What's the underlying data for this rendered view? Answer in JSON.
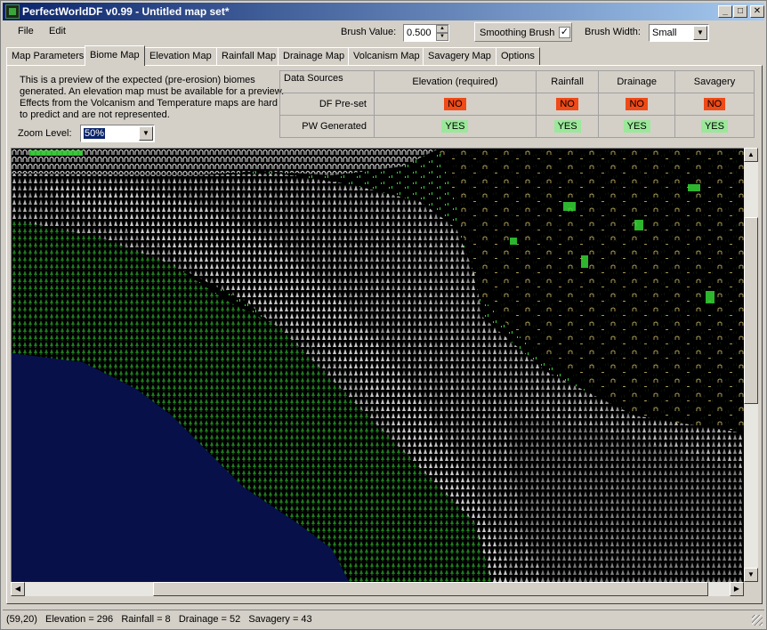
{
  "window": {
    "title": "PerfectWorldDF v0.99 - Untitled map set*"
  },
  "menu": {
    "file": "File",
    "edit": "Edit"
  },
  "toolbar": {
    "brush_value_label": "Brush Value:",
    "brush_value": "0.500",
    "smoothing_label": "Smoothing Brush",
    "smoothing_checked": "✓",
    "brush_width_label": "Brush Width:",
    "brush_width_value": "Small"
  },
  "tabs": [
    {
      "label": "Map Parameters"
    },
    {
      "label": "Biome Map"
    },
    {
      "label": "Elevation Map"
    },
    {
      "label": "Rainfall Map"
    },
    {
      "label": "Drainage Map"
    },
    {
      "label": "Volcanism Map"
    },
    {
      "label": "Savagery Map"
    },
    {
      "label": "Options"
    }
  ],
  "biome": {
    "description": "This is a preview of the expected (pre-erosion) biomes generated. An elevation map must be available for a preview. Effects from the Volcanism and Temperature maps are hard to predict and are not represented.",
    "zoom_label": "Zoom Level:",
    "zoom_value": "50%"
  },
  "data_sources": {
    "title": "Data Sources",
    "columns": [
      "Elevation (required)",
      "Rainfall",
      "Drainage",
      "Savagery"
    ],
    "rows": [
      {
        "label": "DF Pre-set",
        "values": [
          "NO",
          "NO",
          "NO",
          "NO"
        ]
      },
      {
        "label": "PW Generated",
        "values": [
          "YES",
          "YES",
          "YES",
          "YES"
        ]
      }
    ]
  },
  "colors": {
    "water": "#08104a",
    "forest": "#1f7a1f",
    "mountain_light": "#d0d0d0",
    "mountain_dark": "#6a6a6a",
    "grass": "#35d535",
    "desert": "#b8a860",
    "no_badge": "#ef4a17",
    "yes_badge": "#9be89b"
  },
  "status": {
    "text": "(59,20)   Elevation = 296   Rainfall = 8   Drainage = 52   Savagery = 43"
  }
}
